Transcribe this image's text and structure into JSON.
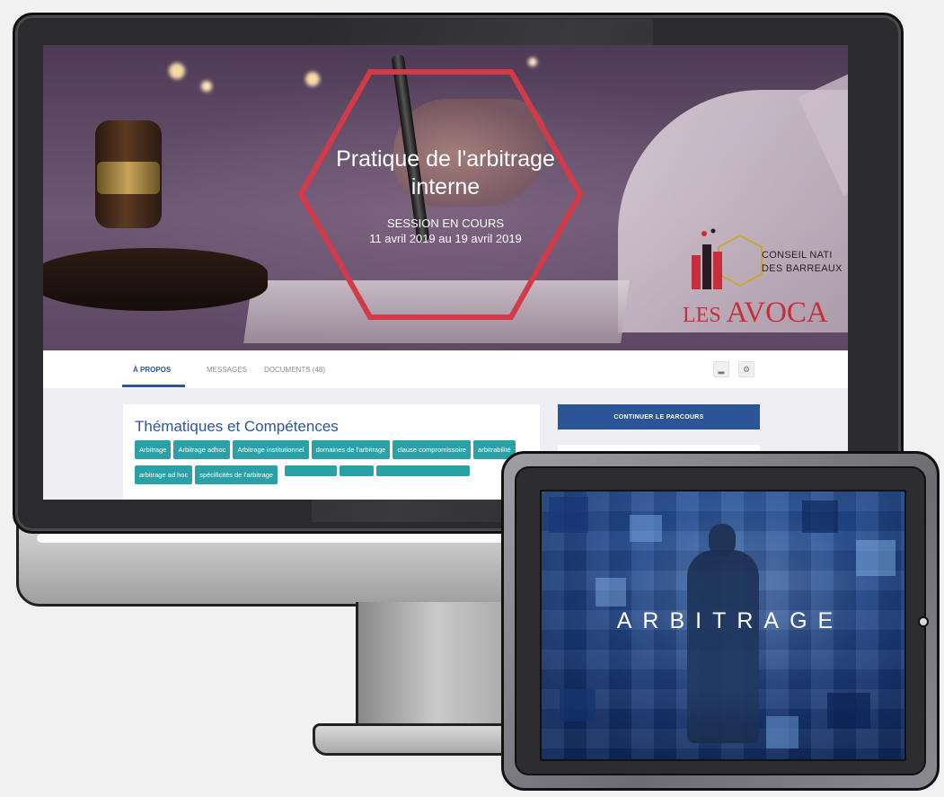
{
  "hero": {
    "title_line1": "Pratique de l'arbitrage",
    "title_line2": "interne",
    "status": "SESSION EN COURS",
    "dates": "11 avril 2019 au 19 avril 2019",
    "hex_color": "#d33a47"
  },
  "logo": {
    "line1": "CONSEIL NATI",
    "line2": "DES BARREAUX",
    "big_small": "LES ",
    "big": "AVOCA",
    "color": "#c72e3b"
  },
  "tabs": [
    {
      "label": "À PROPOS",
      "active": true
    },
    {
      "label": "MESSAGES",
      "active": false
    },
    {
      "label": "DOCUMENTS (48)",
      "active": false
    }
  ],
  "tools": {
    "stats_icon": "bar-chart-icon",
    "settings_icon": "gear-icon"
  },
  "card": {
    "title": "Thématiques et Compétences",
    "tags": [
      "Arbitrage",
      "Arbitrage adhoc",
      "Arbitrage institutionnel",
      "domaines de l'arbitrage",
      "clause compromissoire",
      "arbitrabilité",
      "arbitrage ad hoc",
      "spécificités de l'arbitrage"
    ]
  },
  "cta": {
    "label": "CONTINUER LE PARCOURS",
    "color": "#2c5598"
  },
  "tablet": {
    "word": "ARBITRAGE"
  }
}
